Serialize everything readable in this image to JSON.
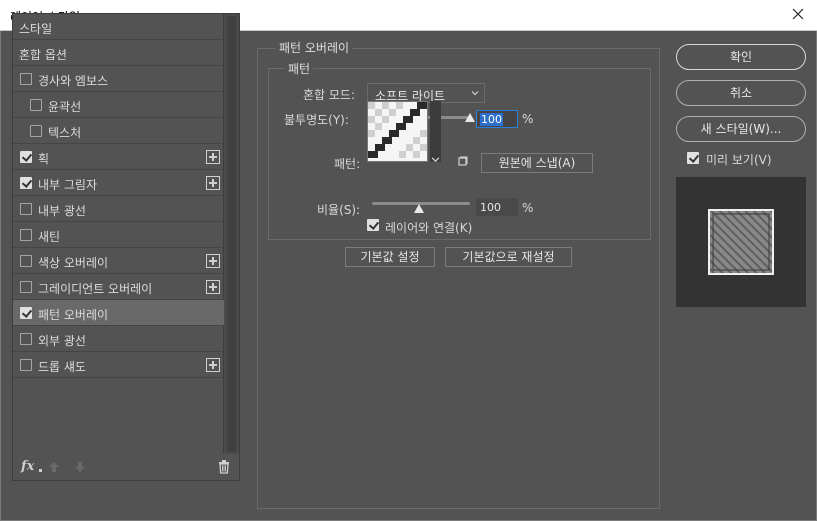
{
  "window": {
    "title": "레이어 스타일"
  },
  "sidebar": {
    "items": [
      {
        "label": "스타일",
        "checkbox": false,
        "checked": false,
        "plus": false,
        "selected": false
      },
      {
        "label": "혼합 옵션",
        "checkbox": false,
        "checked": false,
        "plus": false,
        "selected": false
      },
      {
        "label": "경사와 엠보스",
        "checkbox": true,
        "checked": false,
        "plus": false,
        "selected": false
      },
      {
        "label": "윤곽선",
        "checkbox": true,
        "checked": false,
        "plus": false,
        "selected": false,
        "indent": true
      },
      {
        "label": "텍스처",
        "checkbox": true,
        "checked": false,
        "plus": false,
        "selected": false,
        "indent": true
      },
      {
        "label": "획",
        "checkbox": true,
        "checked": true,
        "plus": true,
        "selected": false
      },
      {
        "label": "내부 그림자",
        "checkbox": true,
        "checked": true,
        "plus": true,
        "selected": false
      },
      {
        "label": "내부 광선",
        "checkbox": true,
        "checked": false,
        "plus": false,
        "selected": false
      },
      {
        "label": "새틴",
        "checkbox": true,
        "checked": false,
        "plus": false,
        "selected": false
      },
      {
        "label": "색상 오버레이",
        "checkbox": true,
        "checked": false,
        "plus": true,
        "selected": false
      },
      {
        "label": "그레이디언트 오버레이",
        "checkbox": true,
        "checked": false,
        "plus": true,
        "selected": false
      },
      {
        "label": "패턴 오버레이",
        "checkbox": true,
        "checked": true,
        "plus": false,
        "selected": true
      },
      {
        "label": "외부 광선",
        "checkbox": true,
        "checked": false,
        "plus": false,
        "selected": false
      },
      {
        "label": "드롭 섀도",
        "checkbox": true,
        "checked": false,
        "plus": true,
        "selected": false
      }
    ],
    "footer": {
      "fx_label": "fx"
    }
  },
  "panel": {
    "group_title": "패턴 오버레이",
    "subgroup_title": "패턴",
    "blend_mode": {
      "label": "혼합 모드:",
      "value": "소프트 라이트"
    },
    "opacity": {
      "label": "불투명도(Y):",
      "value": "100",
      "unit": "%",
      "level": 100
    },
    "pattern": {
      "label": "패턴:",
      "snap_button": "원본에 스냅(A)"
    },
    "scale": {
      "label": "비율(S):",
      "value": "100",
      "unit": "%",
      "level": 0.33
    },
    "link": {
      "label": "레이어와 연결(K)",
      "checked": true
    },
    "default_button": "기본값 설정",
    "reset_button": "기본값으로 재설정"
  },
  "actions": {
    "ok": "확인",
    "cancel": "취소",
    "new_style": "새 스타일(W)...",
    "preview_label": "미리 보기(V)",
    "preview_checked": true
  },
  "colors": {
    "background": "#535353",
    "selected_item": "#696969",
    "focus_blue": "#2f6fcc"
  }
}
